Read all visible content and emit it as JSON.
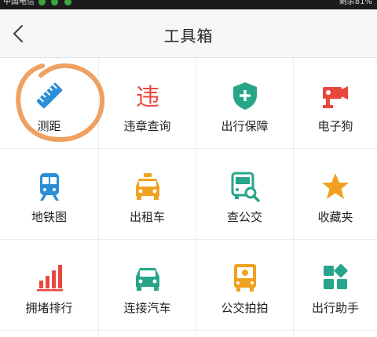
{
  "status_bar": {
    "carrier": "中国电信",
    "battery": "剩余81%"
  },
  "header": {
    "title": "工具箱"
  },
  "tools": [
    {
      "label": "测距",
      "icon": "ruler-icon",
      "color": "#2a8fd6"
    },
    {
      "label": "违章查询",
      "icon": "violation-icon",
      "color": "#e8473e"
    },
    {
      "label": "出行保障",
      "icon": "shield-plus-icon",
      "color": "#27a58a"
    },
    {
      "label": "电子狗",
      "icon": "camera-icon",
      "color": "#e8473e"
    },
    {
      "label": "地铁图",
      "icon": "subway-icon",
      "color": "#2a8fd6"
    },
    {
      "label": "出租车",
      "icon": "taxi-icon",
      "color": "#f0a11f"
    },
    {
      "label": "查公交",
      "icon": "bus-search-icon",
      "color": "#27a58a"
    },
    {
      "label": "收藏夹",
      "icon": "star-icon",
      "color": "#f0a11f"
    },
    {
      "label": "拥堵排行",
      "icon": "bar-chart-icon",
      "color": "#e8473e"
    },
    {
      "label": "连接汽车",
      "icon": "car-icon",
      "color": "#27a58a"
    },
    {
      "label": "公交拍拍",
      "icon": "bus-camera-icon",
      "color": "#f0a11f"
    },
    {
      "label": "出行助手",
      "icon": "apps-icon",
      "color": "#27a58a"
    }
  ],
  "violation_glyph": "违",
  "annotation_color": "#f0a060"
}
